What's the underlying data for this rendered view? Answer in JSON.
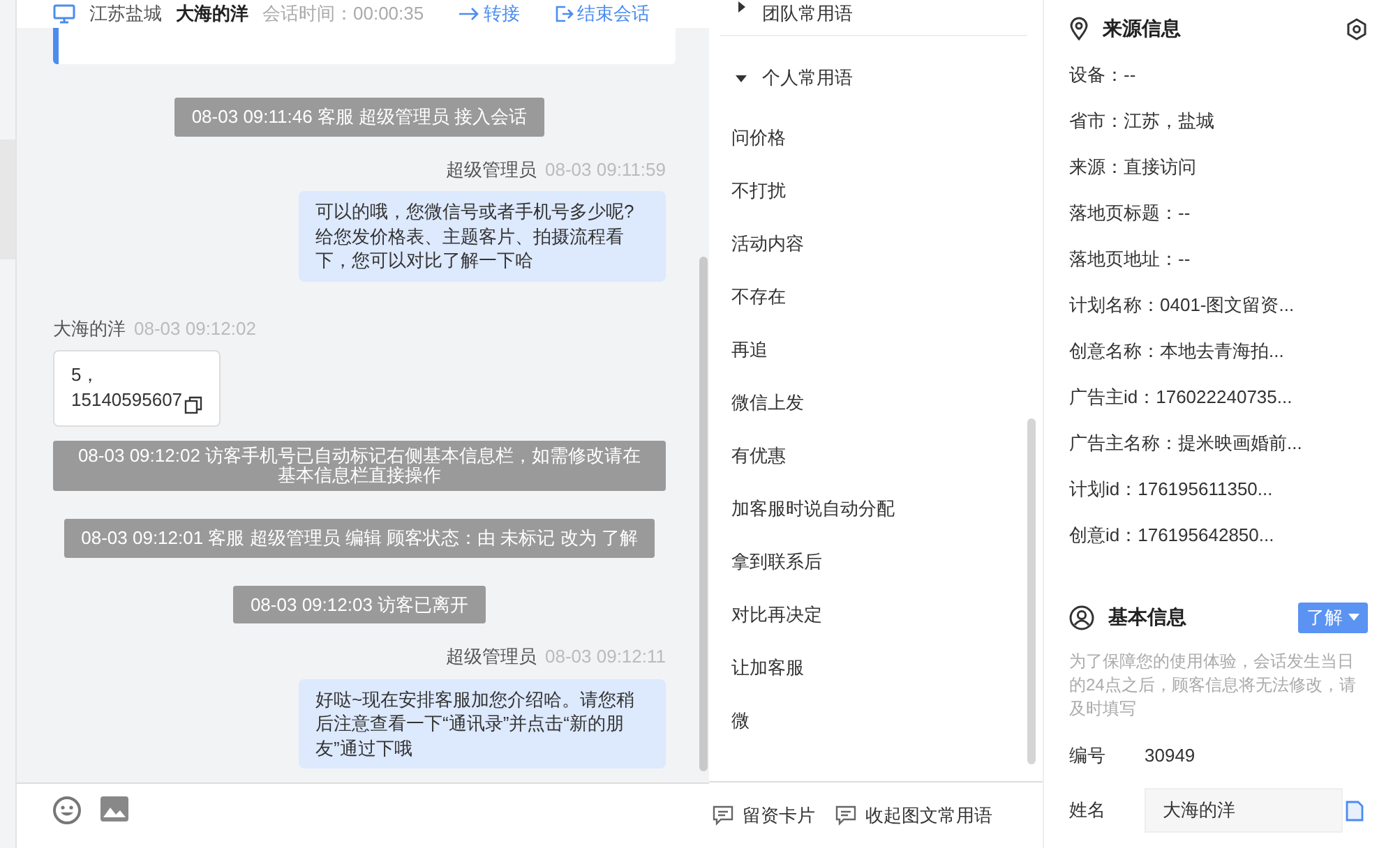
{
  "header": {
    "location": "江苏盐城",
    "visitor": "大海的洋",
    "session_time": "会话时间：00:00:35",
    "actions": [
      {
        "kind": "transfer",
        "label": "转接"
      },
      {
        "kind": "end",
        "label": "结束会话"
      }
    ]
  },
  "messages": [
    {
      "kind": "system",
      "text": "08-03 09:11:46 客服 超级管理员 接入会话"
    },
    {
      "kind": "agent",
      "sender": "超级管理员",
      "time": "08-03 09:11:59",
      "text": "可以的哦，您微信号或者手机号多少呢?给您发价格表、主题客片、拍摄流程看下，您可以对比了解一下哈"
    },
    {
      "kind": "visitor",
      "sender": "大海的洋",
      "time": "08-03 09:12:02",
      "text": "5，\n15140595607"
    },
    {
      "kind": "notice",
      "text": "08-03 09:12:02 访客手机号已自动标记右侧基本信息栏，如需修改请在基本信息栏直接操作"
    },
    {
      "kind": "system",
      "text": "08-03 09:12:01 客服 超级管理员 编辑 顾客状态：由 未标记 改为 了解"
    },
    {
      "kind": "system",
      "text": "08-03 09:12:03 访客已离开"
    },
    {
      "kind": "agent",
      "sender": "超级管理员",
      "time": "08-03 09:12:11",
      "text": "好哒~现在安排客服加您介绍哈。请您稍后注意查看一下“通讯录”并点击“新的朋友”通过下哦"
    }
  ],
  "quick_replies": {
    "groups": [
      {
        "title": "团队常用语",
        "expanded": false
      },
      {
        "title": "个人常用语",
        "expanded": true,
        "items": [
          "问价格",
          "不打扰",
          "活动内容",
          "不存在",
          "再追",
          "微信上发",
          "有优惠",
          "加客服时说自动分配",
          "拿到联系后",
          "对比再决定",
          "让加客服",
          "微"
        ]
      }
    ]
  },
  "footer_actions": [
    "留资卡片",
    "收起图文常用语"
  ],
  "source_info": {
    "title": "来源信息",
    "fields": [
      "设备：--",
      "省市：江苏，盐城",
      "来源：直接访问",
      "落地页标题：--",
      "落地页地址：--",
      "计划名称：0401-图文留资...",
      "创意名称：本地去青海拍...",
      "广告主id：176022240735...",
      "广告主名称：提米映画婚前...",
      "计划id：176195611350...",
      "创意id：176195642850..."
    ]
  },
  "basic_info": {
    "title": "基本信息",
    "status": "了解",
    "note": "为了保障您的使用体验，会话发生当日的24点之后，顾客信息将无法修改，请及时填写",
    "fields": [
      {
        "kind": "text",
        "label": "编号",
        "value": "30949"
      },
      {
        "kind": "input",
        "label": "姓名",
        "value": "大海的洋"
      }
    ]
  }
}
